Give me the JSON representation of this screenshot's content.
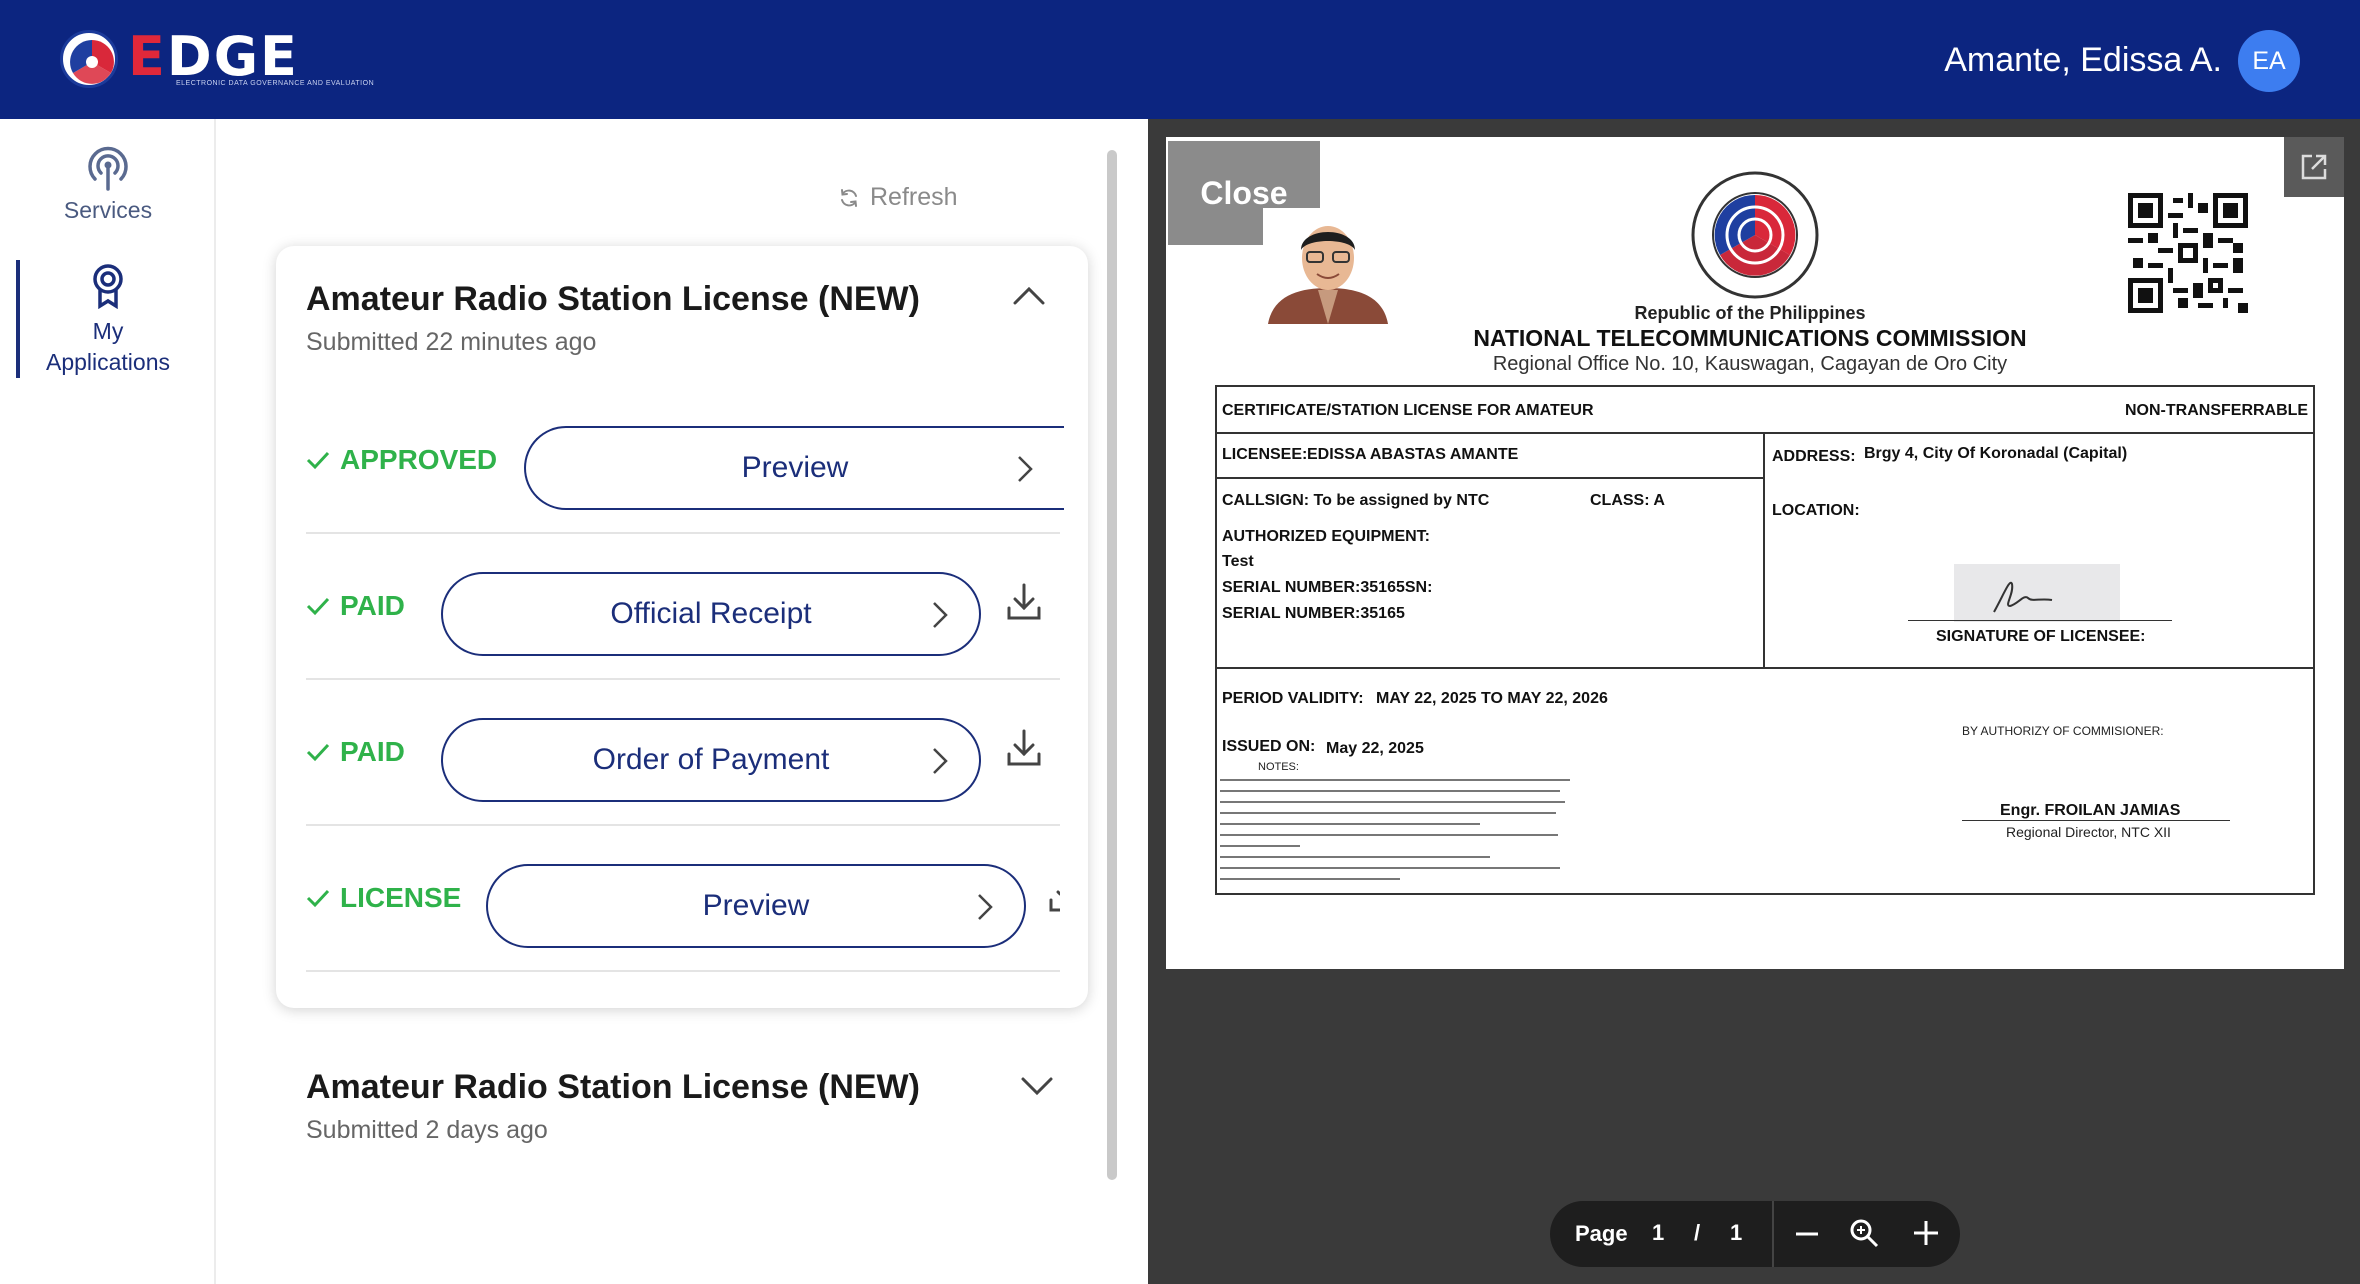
{
  "header": {
    "logo_text_1": "E",
    "logo_text_2": "DGE",
    "logo_sub": "ELECTRONIC DATA GOVERNANCE AND EVALUATION",
    "user_name": "Amante, Edissa A.",
    "avatar_initials": "EA"
  },
  "nav": {
    "items": [
      {
        "label": "Services",
        "icon": "antenna-icon"
      },
      {
        "label": "My Applications",
        "label_line1": "My",
        "label_line2": "Applications",
        "icon": "award-badge-icon"
      }
    ]
  },
  "middle": {
    "refresh_label": "Refresh",
    "applications": [
      {
        "title": "Amateur Radio Station License (NEW)",
        "submitted": "Submitted 22 minutes ago",
        "expanded": true,
        "steps": [
          {
            "status": "APPROVED",
            "action": "Preview",
            "download": false
          },
          {
            "status": "PAID",
            "action": "Official Receipt",
            "download": true
          },
          {
            "status": "PAID",
            "action": "Order of Payment",
            "download": true
          },
          {
            "status": "LICENSE",
            "action": "Preview",
            "download": true
          }
        ]
      },
      {
        "title": "Amateur Radio Station License (NEW)",
        "submitted": "Submitted 2 days ago",
        "expanded": false
      }
    ]
  },
  "viewer": {
    "close_label": "Close",
    "document": {
      "republic": "Republic of the Philippines",
      "agency": "NATIONAL TELECOMMUNICATIONS COMMISSION",
      "office": "Regional Office No. 10, Kauswagan, Cagayan de Oro City",
      "cert_title": "CERTIFICATE/STATION LICENSE FOR AMATEUR",
      "non_transfer": "NON-TRANSFERRABLE",
      "licensee_label": "LICENSEE:",
      "licensee_value": "EDISSA ABASTAS AMANTE",
      "address_label": "ADDRESS:",
      "address_value": "Brgy 4, City Of Koronadal (Capital)",
      "callsign": "CALLSIGN: To be assigned by NTC",
      "class": "CLASS: A",
      "location_label": "LOCATION:",
      "authorized_equipment": "AUTHORIZED EQUIPMENT:",
      "equipment_name": "Test",
      "serial_1": "SERIAL NUMBER:35165SN:",
      "serial_2": "SERIAL NUMBER:35165",
      "signature_label": "SIGNATURE OF LICENSEE:",
      "period_label": "PERIOD VALIDITY:",
      "period_value": "MAY 22, 2025 TO MAY 22, 2026",
      "issued_label": "ISSUED ON:",
      "issued_value": "May 22, 2025",
      "notes_label": "NOTES:",
      "authority": "BY AUTHORIZY OF COMMISIONER:",
      "director_name": "Engr. FROILAN JAMIAS",
      "director_title": "Regional Director, NTC XII"
    },
    "toolbar": {
      "page_label": "Page",
      "current_page": "1",
      "separator": "/",
      "total_pages": "1"
    }
  },
  "colors": {
    "header_bg": "#0c2580",
    "accent": "#1b2e7a",
    "status_green": "#2fb24a",
    "viewer_bg": "#3a3a3a",
    "avatar": "#3d7df0"
  }
}
